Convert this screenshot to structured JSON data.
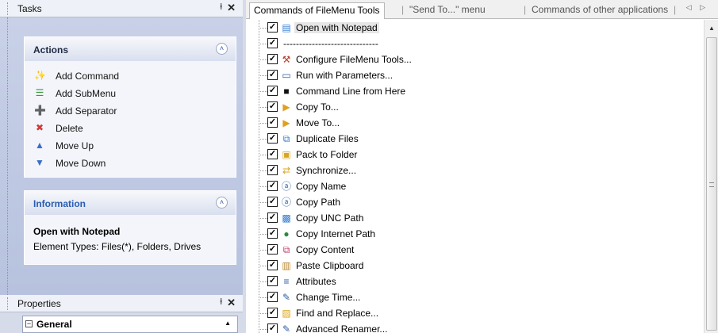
{
  "tasks_pane": {
    "title": "Tasks",
    "pin_glyph": "ⱡ",
    "close_glyph": "✕",
    "actions": {
      "title": "Actions",
      "items": [
        {
          "label": "Add Command",
          "icon": "add-command-icon",
          "glyph": "✨",
          "color": "#3a9a3a"
        },
        {
          "label": "Add SubMenu",
          "icon": "add-submenu-icon",
          "glyph": "☰",
          "color": "#3a9a3a"
        },
        {
          "label": "Add Separator",
          "icon": "add-separator-icon",
          "glyph": "➕",
          "color": "#3a9a3a"
        },
        {
          "label": "Delete",
          "icon": "delete-icon",
          "glyph": "✖",
          "color": "#d03a3a"
        },
        {
          "label": "Move Up",
          "icon": "arrow-up-icon",
          "glyph": "▲",
          "color": "#3a6fc8"
        },
        {
          "label": "Move Down",
          "icon": "arrow-down-icon",
          "glyph": "▼",
          "color": "#3a6fc8"
        }
      ]
    },
    "information": {
      "title": "Information",
      "item_title": "Open with Notepad",
      "element_types": "Element Types: Files(*), Folders, Drives"
    }
  },
  "properties_pane": {
    "title": "Properties",
    "group": "General",
    "expander_glyph": "−"
  },
  "tabs": [
    {
      "label": "Commands of FileMenu Tools",
      "active": true
    },
    {
      "label": "\"Send To...\" menu",
      "active": false
    },
    {
      "label": "Commands of other applications",
      "active": false
    }
  ],
  "tab_nav": "◁ ▷",
  "commands": [
    {
      "label": "Open with Notepad",
      "checked": true,
      "icon": "notepad-icon",
      "glyph": "▤",
      "color": "#2b7bd6",
      "selected": true
    },
    {
      "label": "------------------------------",
      "checked": true,
      "icon": "",
      "glyph": "",
      "color": "#000"
    },
    {
      "label": "Configure FileMenu Tools...",
      "checked": true,
      "icon": "configure-tools-icon",
      "glyph": "⚒",
      "color": "#c0392b"
    },
    {
      "label": "Run with Parameters...",
      "checked": true,
      "icon": "run-parameters-icon",
      "glyph": "▭",
      "color": "#2b5fa8"
    },
    {
      "label": "Command Line from Here",
      "checked": true,
      "icon": "command-line-icon",
      "glyph": "■",
      "color": "#111"
    },
    {
      "label": "Copy To...",
      "checked": true,
      "icon": "copy-to-icon",
      "glyph": "▶",
      "color": "#e0a020"
    },
    {
      "label": "Move To...",
      "checked": true,
      "icon": "move-to-icon",
      "glyph": "▶",
      "color": "#e0a020"
    },
    {
      "label": "Duplicate Files",
      "checked": true,
      "icon": "duplicate-files-icon",
      "glyph": "⧉",
      "color": "#2b7bd6"
    },
    {
      "label": "Pack to Folder",
      "checked": true,
      "icon": "pack-folder-icon",
      "glyph": "▣",
      "color": "#d8a520"
    },
    {
      "label": "Synchronize...",
      "checked": true,
      "icon": "synchronize-icon",
      "glyph": "⇄",
      "color": "#d8a520"
    },
    {
      "label": "Copy Name",
      "checked": true,
      "icon": "copy-name-icon",
      "glyph": "ⓐ",
      "color": "#2b5fa8"
    },
    {
      "label": "Copy Path",
      "checked": true,
      "icon": "copy-path-icon",
      "glyph": "ⓐ",
      "color": "#2b5fa8"
    },
    {
      "label": "Copy UNC Path",
      "checked": true,
      "icon": "copy-unc-path-icon",
      "glyph": "▩",
      "color": "#2b7bd6"
    },
    {
      "label": "Copy Internet Path",
      "checked": true,
      "icon": "copy-internet-path-icon",
      "glyph": "●",
      "color": "#2b8a3e"
    },
    {
      "label": "Copy Content",
      "checked": true,
      "icon": "copy-content-icon",
      "glyph": "⧉",
      "color": "#c03a6a"
    },
    {
      "label": "Paste Clipboard",
      "checked": true,
      "icon": "paste-clipboard-icon",
      "glyph": "▥",
      "color": "#b8862a"
    },
    {
      "label": "Attributes",
      "checked": true,
      "icon": "attributes-icon",
      "glyph": "≡",
      "color": "#2b5fa8"
    },
    {
      "label": "Change Time...",
      "checked": true,
      "icon": "change-time-icon",
      "glyph": "✎",
      "color": "#2b5fa8"
    },
    {
      "label": "Find and Replace...",
      "checked": true,
      "icon": "find-replace-icon",
      "glyph": "▨",
      "color": "#d8a520"
    },
    {
      "label": "Advanced Renamer...",
      "checked": true,
      "icon": "advanced-renamer-icon",
      "glyph": "✎",
      "color": "#2b5fa8"
    }
  ],
  "checkmark": "✓",
  "scroll_up_glyph": "▲",
  "collapse_glyph": "˄"
}
